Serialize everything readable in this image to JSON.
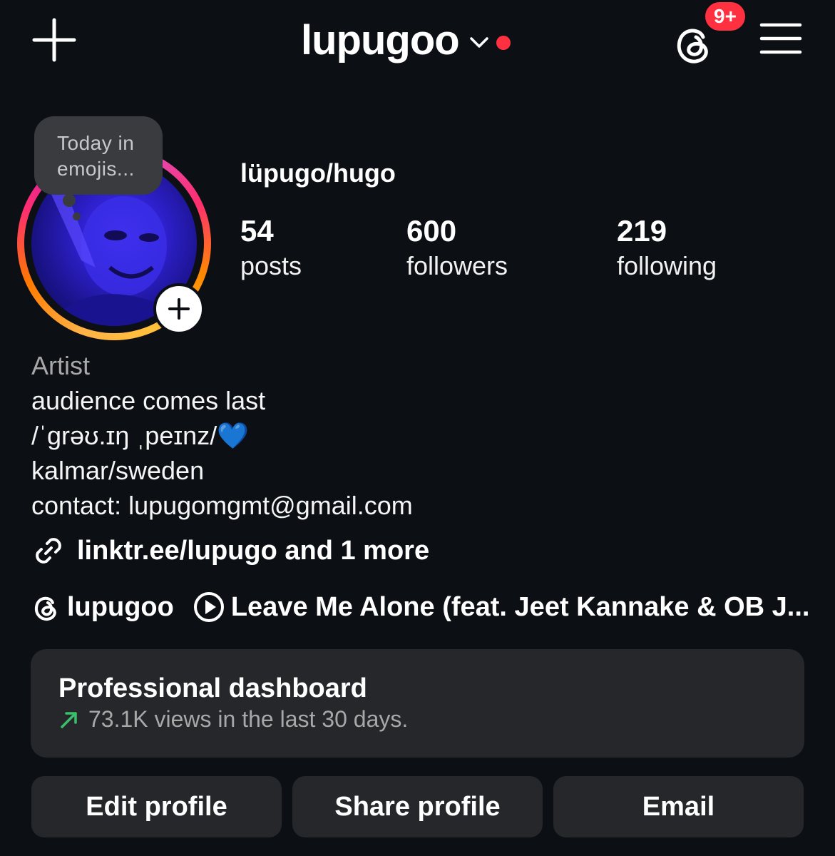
{
  "header": {
    "username": "lupugoo",
    "notification_badge": "9+",
    "icons": [
      "plus-icon",
      "chevron-down-icon",
      "threads-icon",
      "menu-icon"
    ],
    "accent_color": "#ff3040"
  },
  "note": {
    "text_line1": "Today in",
    "text_line2": "emojis..."
  },
  "profile": {
    "display_name": "lüpugo/hugo",
    "stats": {
      "posts_count": "54",
      "posts_label": "posts",
      "followers_count": "600",
      "followers_label": "followers",
      "following_count": "219",
      "following_label": "following"
    },
    "category": "Artist",
    "bio_lines": [
      "audience comes last",
      "/ˈɡrəʊ.ɪŋ ˌpeɪnz/💙",
      "kalmar/sweden",
      "contact: lupugomgmt@gmail.com"
    ],
    "link": "linktr.ee/lupugo and 1 more",
    "threads_handle": "lupugoo",
    "music": "Leave Me Alone (feat. Jeet Kannake & OB J..."
  },
  "dashboard": {
    "title": "Professional dashboard",
    "subtitle": "73.1K views in the last 30 days.",
    "trend_color": "#3bbf6a"
  },
  "actions": {
    "edit": "Edit profile",
    "share": "Share profile",
    "email": "Email"
  }
}
